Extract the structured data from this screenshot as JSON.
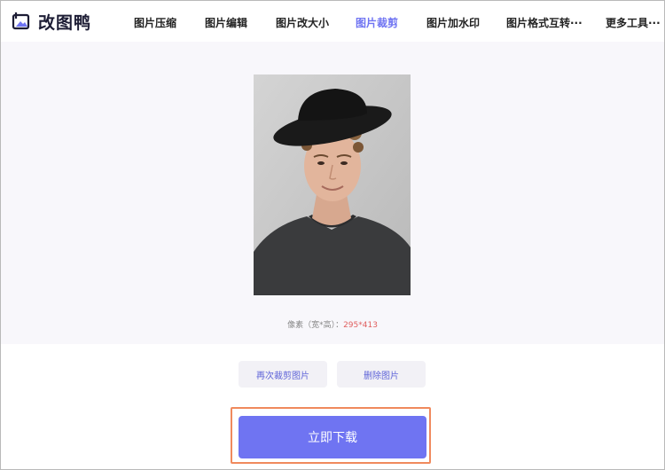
{
  "app": {
    "logo_text": "改图鸭"
  },
  "nav": {
    "items": [
      {
        "label": "图片压缩"
      },
      {
        "label": "图片编辑"
      },
      {
        "label": "图片改大小"
      },
      {
        "label": "图片裁剪"
      },
      {
        "label": "图片加水印"
      },
      {
        "label": "图片格式互转···"
      },
      {
        "label": "更多工具···"
      }
    ],
    "active_index": 3
  },
  "preview": {
    "dims_label": "像素（宽*高）：",
    "dims_value": "295*413"
  },
  "actions": {
    "recrop_label": "再次裁剪图片",
    "delete_label": "删除图片",
    "download_label": "立即下载"
  },
  "colors": {
    "accent": "#6f74f2",
    "highlight_border": "#f08a5d",
    "dims_value": "#e06060"
  }
}
